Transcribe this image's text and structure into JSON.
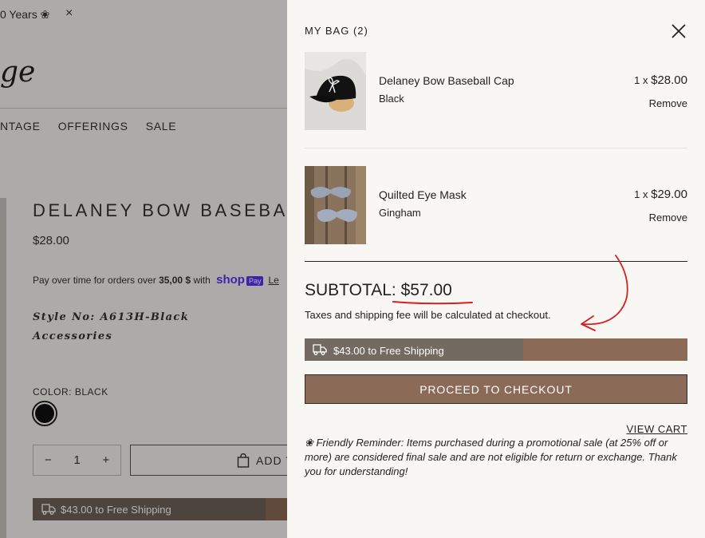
{
  "background_page": {
    "announcement": "0 Years ❀",
    "announcement_close": "×",
    "logo_fragment": "ge",
    "nav": [
      "NTAGE",
      "OFFERINGS",
      "SALE"
    ],
    "product_title": "DELANEY BOW BASEBA",
    "price": "$28.00",
    "pay_over_prefix": "Pay over time for orders over ",
    "pay_over_amount": "35,00 $",
    "pay_over_suffix": " with ",
    "shop_logo": "shop",
    "pay_badge": "Pay",
    "learn_more": "Le",
    "style_no": "Style No: A613H-Black",
    "category": "Accessories",
    "color_label": "COLOR:",
    "color_value": "BLACK",
    "qty_minus": "−",
    "qty_value": "1",
    "qty_plus": "+",
    "add_to_cart": "ADD T",
    "shipping_text": "$43.00 to Free Shipping"
  },
  "cart": {
    "title": "MY BAG (2)",
    "items": [
      {
        "name": "Delaney Bow Baseball Cap",
        "variant": "Black",
        "qty": "1 x",
        "price": "$28.00",
        "remove": "Remove"
      },
      {
        "name": "Quilted Eye Mask",
        "variant": "Gingham",
        "qty": "1 x",
        "price": "$29.00",
        "remove": "Remove"
      }
    ],
    "subtotal_label": "SUBTOTAL:",
    "subtotal_value": "$57.00",
    "tax_note": "Taxes and shipping fee will be calculated at checkout.",
    "shipping_text": "$43.00 to Free Shipping",
    "shipping_progress": 0.57,
    "checkout": "PROCEED TO CHECKOUT",
    "view_cart": "VIEW CART",
    "reminder": "❀ Friendly Reminder: Items purchased during a promotional sale (at 25% off or more) are considered final sale and are not eligible for return or exchange. Thank you for understanding!"
  },
  "colors": {
    "accent_brown": "#8b6b57",
    "progress_fill": "#736a62",
    "annotation_red": "#d61f1f"
  }
}
